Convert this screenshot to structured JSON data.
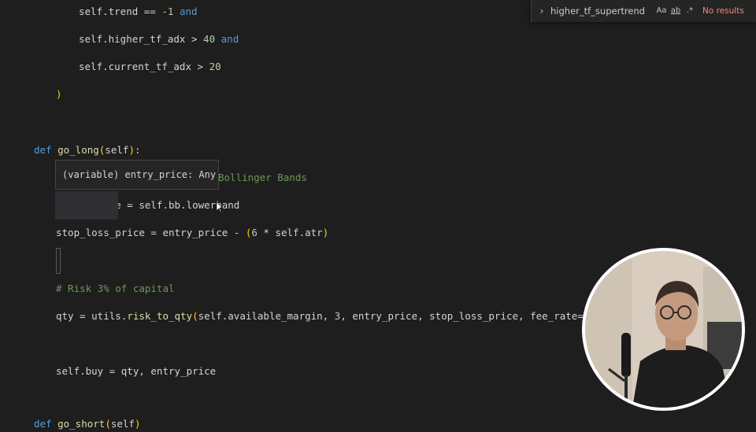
{
  "editor": {
    "lines": [
      {
        "indent": "        ",
        "tokens": [
          [
            "ident",
            "self.trend == "
          ],
          [
            "num",
            "-1"
          ],
          [
            "ident",
            " "
          ],
          [
            "kw",
            "and"
          ]
        ]
      },
      {
        "indent": "        ",
        "tokens": [
          [
            "ident",
            "self.higher_tf_adx > "
          ],
          [
            "num",
            "40"
          ],
          [
            "ident",
            " "
          ],
          [
            "kw",
            "and"
          ]
        ]
      },
      {
        "indent": "        ",
        "tokens": [
          [
            "ident",
            "self.current_tf_adx > "
          ],
          [
            "num",
            "20"
          ]
        ]
      },
      {
        "indent": "    ",
        "tokens": [
          [
            "paren-y",
            ")"
          ]
        ]
      },
      {
        "indent": "",
        "tokens": [
          [
            "kw",
            "def"
          ],
          [
            "ident",
            " "
          ],
          [
            "fn",
            "go_long"
          ],
          [
            "paren-y",
            "("
          ],
          [
            "ident",
            "self"
          ],
          [
            "paren-y",
            ")"
          ],
          [
            "ident",
            ":"
          ]
        ]
      },
      {
        "indent": "                      ",
        "tokens": [
          [
            "cm",
            "Bollinger Bands"
          ]
        ]
      },
      {
        "indent": "    ",
        "tokens": [
          [
            "ident",
            "entry_price = self.bb.lowerband"
          ]
        ]
      },
      {
        "indent": "    ",
        "tokens": [
          [
            "ident",
            "stop_loss_price = entry_price - "
          ],
          [
            "paren-y",
            "("
          ],
          [
            "num",
            "6"
          ],
          [
            "ident",
            " * self.atr"
          ],
          [
            "paren-y",
            ")"
          ]
        ]
      },
      {
        "indent": "    ",
        "tokens": [
          [
            "cm",
            "# Risk 3% of capital"
          ]
        ]
      },
      {
        "indent": "    ",
        "tokens": [
          [
            "ident",
            "qty = utils."
          ],
          [
            "fn",
            "risk_to_qty"
          ],
          [
            "paren-y",
            "("
          ],
          [
            "ident",
            "self.available_margin, "
          ],
          [
            "num",
            "3"
          ],
          [
            "ident",
            ", entry_price, stop_loss_price, fee_rate=self."
          ]
        ]
      },
      {
        "indent": "    ",
        "tokens": [
          [
            "ident",
            "self.buy = qty, entry_price"
          ]
        ]
      },
      {
        "indent": "",
        "tokens": [
          [
            "kw",
            "def"
          ],
          [
            "ident",
            " "
          ],
          [
            "fn",
            "go_short"
          ],
          [
            "paren-y",
            "("
          ],
          [
            "ident",
            "self"
          ],
          [
            "paren-y",
            ")"
          ]
        ]
      }
    ]
  },
  "find": {
    "query": "higher_tf_supertrend",
    "match_case": "Aa",
    "whole_word": "ab",
    "regex": ".*",
    "status": "No results"
  },
  "hover": {
    "text": "(variable) entry_price: Any"
  },
  "webcam": {
    "icon": "person-video-icon"
  }
}
